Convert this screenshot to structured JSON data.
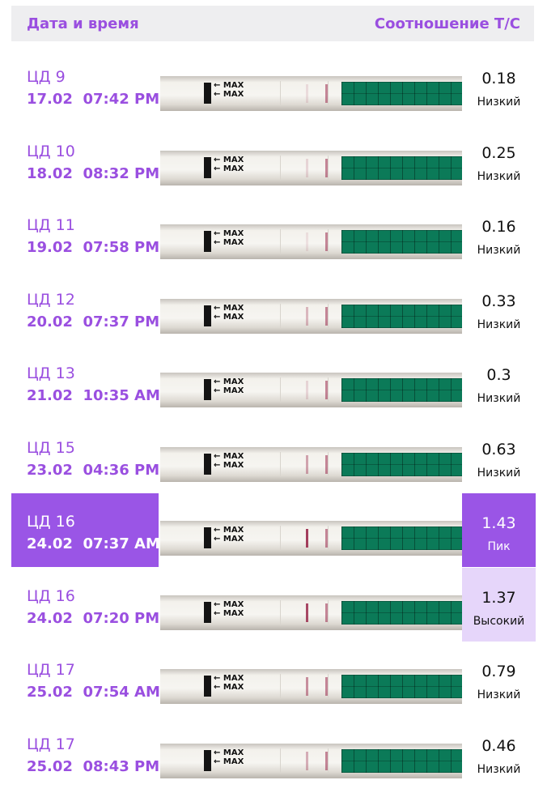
{
  "header": {
    "date_label": "Дата и время",
    "ratio_label": "Соотношение Т/С"
  },
  "strip_mark": "MAX",
  "rows": [
    {
      "cd": "ЦД 9",
      "date": "17.02",
      "time": "07:42 PM",
      "ratio": "0.18",
      "level": "Низкий",
      "test_line": 0.12
    },
    {
      "cd": "ЦД 10",
      "date": "18.02",
      "time": "08:32 PM",
      "ratio": "0.25",
      "level": "Низкий",
      "test_line": 0.15
    },
    {
      "cd": "ЦД 11",
      "date": "19.02",
      "time": "07:58 PM",
      "ratio": "0.16",
      "level": "Низкий",
      "test_line": 0.1
    },
    {
      "cd": "ЦД 12",
      "date": "20.02",
      "time": "07:37 PM",
      "ratio": "0.33",
      "level": "Низкий",
      "test_line": 0.3
    },
    {
      "cd": "ЦД 13",
      "date": "21.02",
      "time": "10:35 AM",
      "ratio": "0.3",
      "level": "Низкий",
      "test_line": 0.15
    },
    {
      "cd": "ЦД 15",
      "date": "23.02",
      "time": "04:36 PM",
      "ratio": "0.63",
      "level": "Низкий",
      "test_line": 0.4
    },
    {
      "cd": "ЦД 16",
      "date": "24.02",
      "time": "07:37 AM",
      "ratio": "1.43",
      "level": "Пик",
      "test_line": 0.9,
      "state": "selected"
    },
    {
      "cd": "ЦД 16",
      "date": "24.02",
      "time": "07:20 PM",
      "ratio": "1.37",
      "level": "Высокий",
      "test_line": 0.85,
      "state": "high"
    },
    {
      "cd": "ЦД 17",
      "date": "25.02",
      "time": "07:54 AM",
      "ratio": "0.79",
      "level": "Низкий",
      "test_line": 0.5
    },
    {
      "cd": "ЦД 17",
      "date": "25.02",
      "time": "08:43 PM",
      "ratio": "0.46",
      "level": "Низкий",
      "test_line": 0.35
    }
  ]
}
